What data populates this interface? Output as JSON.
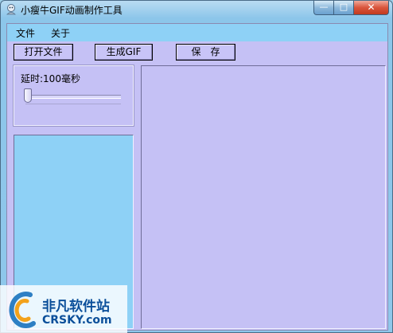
{
  "window": {
    "title": "小瘦牛GIF动画制作工具",
    "controls": {
      "minimize": "—",
      "maximize": "□",
      "close": "✕"
    }
  },
  "menubar": {
    "file": "文件",
    "about": "关于"
  },
  "toolbar": {
    "open_label": "打开文件",
    "generate_label": "生成GIF",
    "save_label": "保　存"
  },
  "delay": {
    "label": "延时:100毫秒",
    "value_ms": 100
  },
  "watermark": {
    "brand_cn": "非凡软件站",
    "brand_en": "CRSKY.com"
  },
  "colors": {
    "client_bg": "#c5c1f5",
    "menubar_bg": "#8ed1f6",
    "list_bg": "#8ed1f6",
    "watermark_text": "#0b4f9a"
  }
}
